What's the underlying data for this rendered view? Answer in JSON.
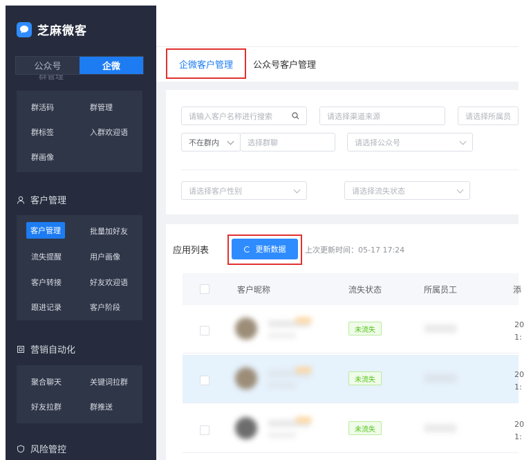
{
  "app": {
    "name": "芝麻微客"
  },
  "account_switch": {
    "options": [
      "公众号",
      "企微"
    ],
    "active": "企微"
  },
  "sidebar": {
    "ghost_text": "群管理",
    "group_items": [
      "群活码",
      "群管理",
      "群标签",
      "入群欢迎语",
      "群画像"
    ],
    "customer_section": "客户管理",
    "customer_items": [
      "客户管理",
      "批量加好友",
      "流失提醒",
      "用户画像",
      "客户转接",
      "好友欢迎语",
      "跟进记录",
      "客户阶段"
    ],
    "marketing_section": "营销自动化",
    "marketing_items": [
      "聚合聊天",
      "关键词拉群",
      "好友拉群",
      "群推送"
    ],
    "risk_section": "风险管控"
  },
  "tabs": [
    "企微客户管理",
    "公众号客户管理"
  ],
  "filters": {
    "search_placeholder": "请输入客户名称进行搜索",
    "channel": "请选择渠道来源",
    "staff": "请选择所属员",
    "group_status": "不在群内",
    "group_select": "选择群聊",
    "official_account": "请选择公众号",
    "gender": "请选择客户性别",
    "churn_status": "请选择流失状态"
  },
  "list": {
    "title": "应用列表",
    "refresh_button": "更新数据",
    "last_update": "上次更新时间：05-17 17:24",
    "columns": [
      "客户昵称",
      "流失状态",
      "所属员工",
      "添"
    ],
    "rows": [
      {
        "status": "未流失",
        "date_top": "20",
        "date_bottom": "1:"
      },
      {
        "status": "未流失",
        "date_top": "20",
        "date_bottom": "1:"
      },
      {
        "status": "未流失",
        "date_top": "20",
        "date_bottom": "1:"
      }
    ]
  },
  "colors": {
    "primary": "#1d7cf2",
    "sidebar_bg": "#262c3d",
    "highlight_box": "#e0312f",
    "success": "#52c41a"
  }
}
